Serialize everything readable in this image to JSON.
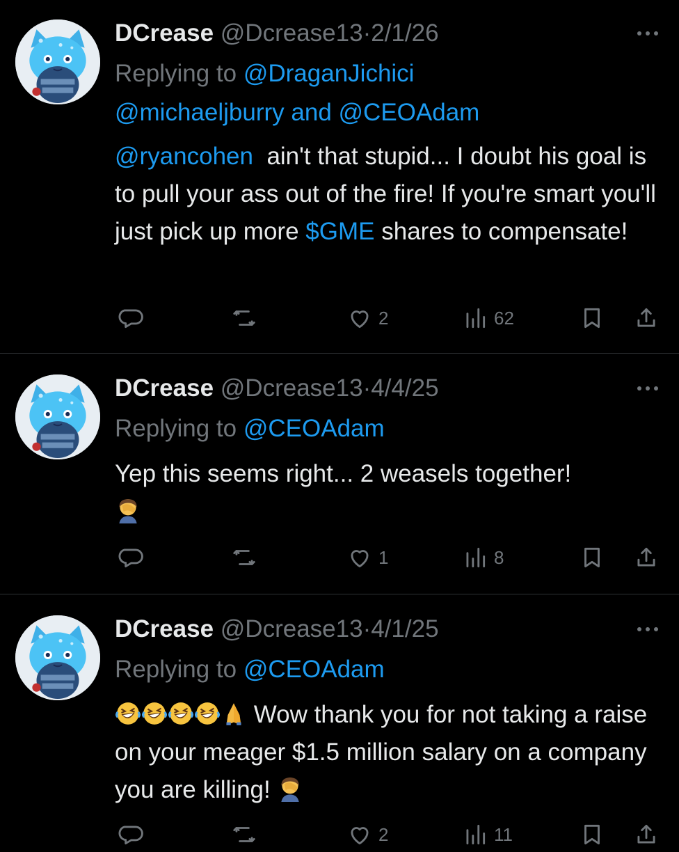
{
  "tweets": [
    {
      "name": "DCrease",
      "handle": "@Dcrease13",
      "sep": "·",
      "date": "2/1/26",
      "replying_label": "Replying to",
      "replying_to_1": "@DraganJichici",
      "replying_to_2": "@michaeljburry",
      "replying_and": "and",
      "replying_to_3": "@CEOAdam",
      "body_mention": "@ryancohen",
      "body_part1": "ain't that stupid... I doubt his goal is to pull your ass out of the fire! If you're smart you'll just pick up more",
      "body_cashtag": "$GME",
      "body_part2": "shares to compensate!",
      "likes": "2",
      "views": "62"
    },
    {
      "name": "DCrease",
      "handle": "@Dcrease13",
      "sep": "·",
      "date": "4/4/25",
      "replying_label": "Replying to",
      "replying_to_1": "@CEOAdam",
      "body": "Yep this seems right... 2 weasels together!",
      "body_emoji": "face-palm-emoji",
      "likes": "1",
      "views": "8"
    },
    {
      "name": "DCrease",
      "handle": "@Dcrease13",
      "sep": "·",
      "date": "4/1/25",
      "replying_label": "Replying to",
      "replying_to_1": "@CEOAdam",
      "body_leading_emojis": [
        "rolling-laughing-emoji",
        "rolling-laughing-emoji",
        "rolling-laughing-emoji",
        "rolling-laughing-emoji",
        "folded-hands-emoji"
      ],
      "body": "Wow thank you for not taking a raise on your meager $1.5 million salary on a company you are killing!",
      "body_emoji": "face-palm-emoji",
      "likes": "2",
      "views": "11"
    }
  ],
  "colors": {
    "background": "#000000",
    "text": "#e7e9ea",
    "muted": "#71767b",
    "link": "#1d9bf0",
    "divider": "#2f3336"
  },
  "icons": {
    "reply": "reply-icon",
    "repost": "repost-icon",
    "like": "heart-icon",
    "views": "views-icon",
    "bookmark": "bookmark-icon",
    "share": "share-icon",
    "more": "more-icon"
  }
}
